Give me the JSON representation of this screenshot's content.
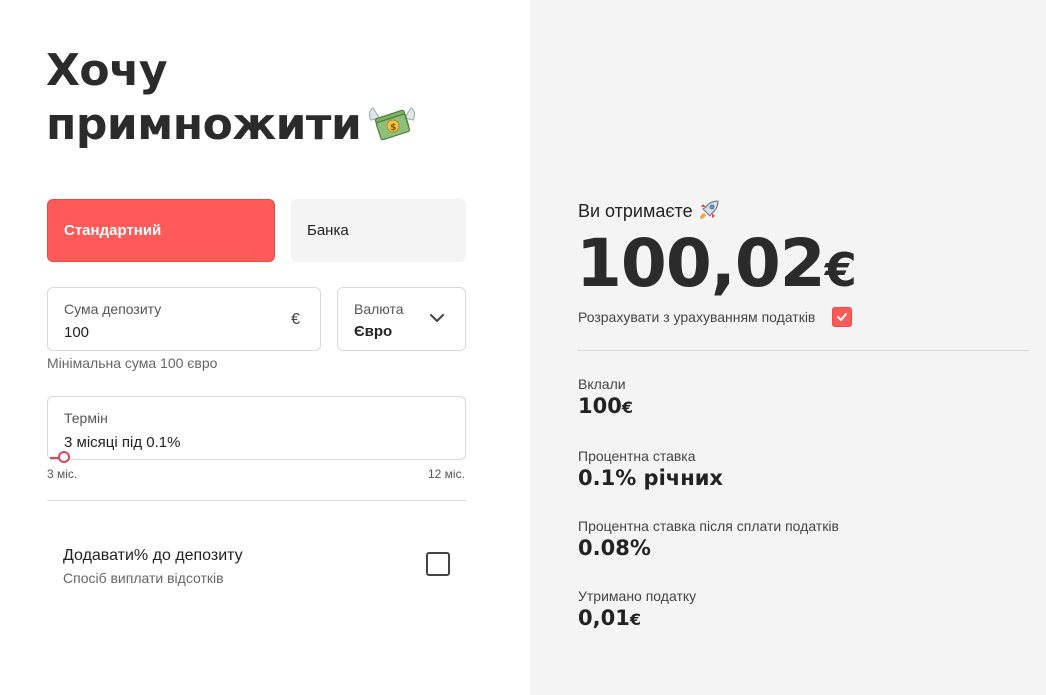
{
  "header": {
    "title_line1": "Хочу",
    "title_line2": "примножити",
    "title_icon": "money-with-wings-icon"
  },
  "tabs": [
    {
      "label": "Стандартний",
      "active": true
    },
    {
      "label": "Банка",
      "active": false
    }
  ],
  "form": {
    "amount": {
      "label": "Сума депозиту",
      "value": "100",
      "currency_symbol": "€"
    },
    "currency": {
      "label": "Валюта",
      "value": "Євро",
      "icon": "chevron-down-icon"
    },
    "amount_hint": "Мінімальна сума 100 євро",
    "term": {
      "label": "Термін",
      "value": "3 місяці під 0.1%",
      "slider_min": "3 міс.",
      "slider_max": "12 міс.",
      "slider_fraction": 0
    },
    "add_interest": {
      "label": "Додавати% до депозиту",
      "sublabel": "Спосіб виплати відсотків",
      "checked": false
    }
  },
  "result": {
    "receive_label": "Ви отримаєте",
    "receive_icon": "rocket-icon",
    "total": "100,02",
    "total_currency": "€",
    "tax_label": "Розрахувати з урахуванням податків",
    "tax_checked": true,
    "stats": [
      {
        "label": "Вклали",
        "value": "100",
        "currency": "€"
      },
      {
        "label": "Процентна ставка",
        "value": "0.1% річних",
        "currency": ""
      },
      {
        "label": "Процентна ставка після сплати податків",
        "value": "0.08%",
        "currency": ""
      },
      {
        "label": "Утримано податку",
        "value": "0,01",
        "currency": "€"
      }
    ]
  },
  "colors": {
    "accent": "#ff5a5a",
    "panel_bg": "#f4f4f4",
    "text_dark": "#2b2b2b"
  }
}
